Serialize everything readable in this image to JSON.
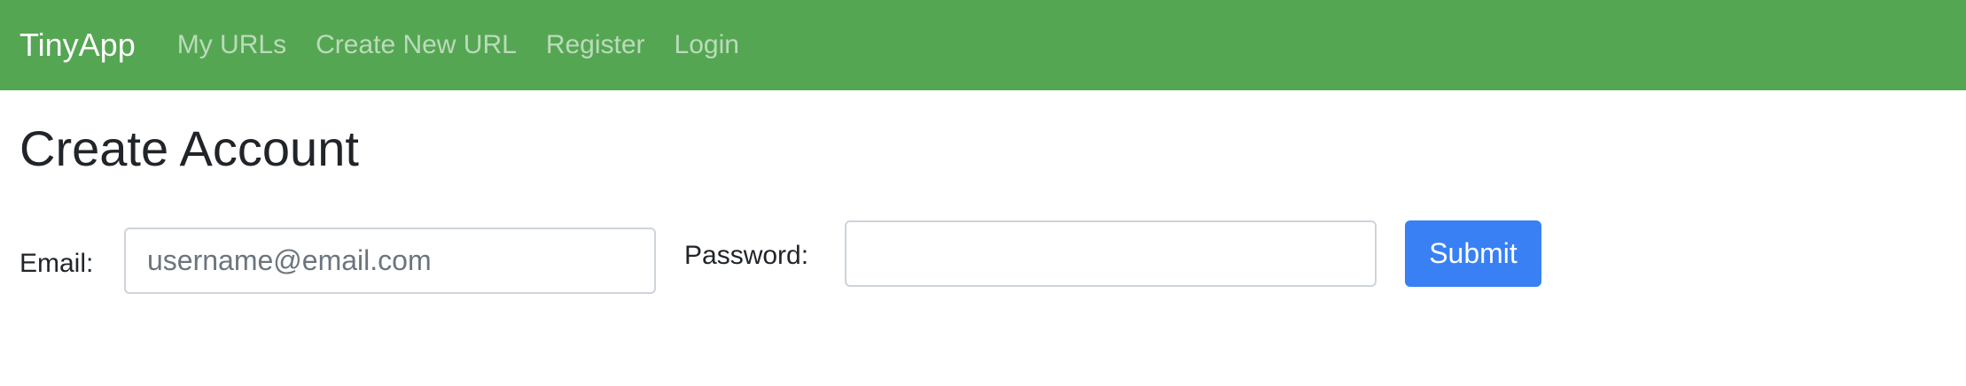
{
  "navbar": {
    "brand": "TinyApp",
    "links": [
      "My URLs",
      "Create New URL",
      "Register",
      "Login"
    ],
    "background_color": "#55a653"
  },
  "page": {
    "title": "Create Account"
  },
  "form": {
    "email_label": "Email:",
    "email_placeholder": "username@email.com",
    "email_value": "",
    "password_label": "Password:",
    "password_value": "",
    "submit_label": "Submit",
    "submit_color": "#3880f4"
  }
}
